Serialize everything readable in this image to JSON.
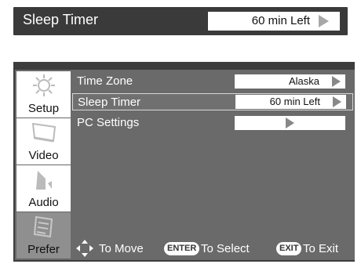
{
  "banner": {
    "title": "Sleep Timer",
    "value": "60 min Left"
  },
  "sidebar": {
    "items": [
      {
        "label": "Setup",
        "icon": "gear-icon"
      },
      {
        "label": "Video",
        "icon": "tv-icon"
      },
      {
        "label": "Audio",
        "icon": "speaker-icon"
      },
      {
        "label": "Prefer",
        "icon": "preferences-icon",
        "active": true
      }
    ]
  },
  "menu": {
    "rows": [
      {
        "label": "Time Zone",
        "value": "Alaska"
      },
      {
        "label": "Sleep Timer",
        "value": "60 min Left",
        "selected": true
      },
      {
        "label": "PC Settings",
        "value": ""
      }
    ]
  },
  "footer": {
    "move": "To Move",
    "enter_key": "ENTER",
    "select": "To Select",
    "exit_key": "EXIT",
    "exit": "To Exit"
  }
}
